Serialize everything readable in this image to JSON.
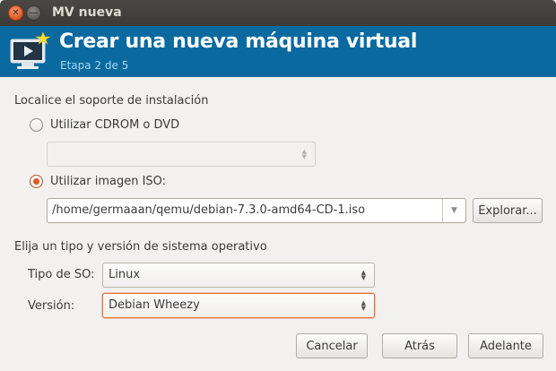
{
  "window": {
    "title": "MV nueva"
  },
  "banner": {
    "title": "Crear una nueva máquina virtual",
    "step": "Etapa 2 de 5"
  },
  "install": {
    "heading": "Localice el soporte de instalación",
    "cdrom_label": "Utilizar CDROM o DVD",
    "cdrom_selected": false,
    "iso_label": "Utilizar imagen ISO:",
    "iso_selected": true,
    "iso_path": "/home/germaaan/qemu/debian-7.3.0-amd64-CD-1.iso",
    "browse_label": "Explorar..."
  },
  "os": {
    "heading": "Elija un tipo y versión de sistema operativo",
    "type_label": "Tipo de SO:",
    "type_value": "Linux",
    "version_label": "Versión:",
    "version_value": "Debian Wheezy"
  },
  "buttons": {
    "cancel": "Cancelar",
    "back": "Atrás",
    "forward": "Adelante"
  },
  "colors": {
    "banner": "#0a6aa0",
    "radio_accent": "#e05a21",
    "focus_ring": "#e0703a"
  }
}
